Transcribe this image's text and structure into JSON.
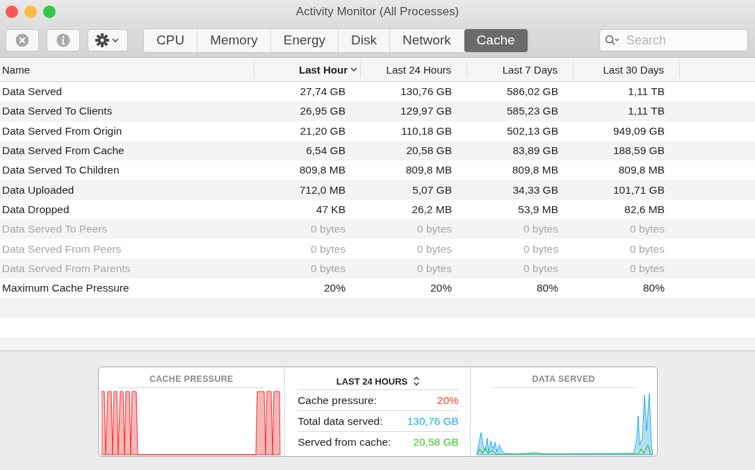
{
  "window": {
    "title": "Activity Monitor (All Processes)"
  },
  "toolbar": {
    "tabs": [
      {
        "label": "CPU",
        "selected": false
      },
      {
        "label": "Memory",
        "selected": false
      },
      {
        "label": "Energy",
        "selected": false
      },
      {
        "label": "Disk",
        "selected": false
      },
      {
        "label": "Network",
        "selected": false
      },
      {
        "label": "Cache",
        "selected": true
      }
    ],
    "search": {
      "placeholder": "Search"
    }
  },
  "table": {
    "columns": [
      {
        "label": "Name",
        "sorted": false
      },
      {
        "label": "Last Hour",
        "sorted": true
      },
      {
        "label": "Last 24 Hours",
        "sorted": false
      },
      {
        "label": "Last 7 Days",
        "sorted": false
      },
      {
        "label": "Last 30 Days",
        "sorted": false
      }
    ],
    "rows": [
      {
        "cells": [
          "Data Served",
          "27,74 GB",
          "130,76 GB",
          "586,02 GB",
          "1,11 TB"
        ],
        "disabled": false
      },
      {
        "cells": [
          "Data Served To Clients",
          "26,95 GB",
          "129,97 GB",
          "585,23 GB",
          "1,11 TB"
        ],
        "disabled": false
      },
      {
        "cells": [
          "Data Served From Origin",
          "21,20 GB",
          "110,18 GB",
          "502,13 GB",
          "949,09 GB"
        ],
        "disabled": false
      },
      {
        "cells": [
          "Data Served From Cache",
          "6,54 GB",
          "20,58 GB",
          "83,89 GB",
          "188,59 GB"
        ],
        "disabled": false
      },
      {
        "cells": [
          "Data Served To Children",
          "809,8 MB",
          "809,8 MB",
          "809,8 MB",
          "809,8 MB"
        ],
        "disabled": false
      },
      {
        "cells": [
          "Data Uploaded",
          "712,0 MB",
          "5,07 GB",
          "34,33 GB",
          "101,71 GB"
        ],
        "disabled": false
      },
      {
        "cells": [
          "Data Dropped",
          "47 KB",
          "26,2 MB",
          "53,9 MB",
          "82,6 MB"
        ],
        "disabled": false
      },
      {
        "cells": [
          "Data Served To Peers",
          "0 bytes",
          "0 bytes",
          "0 bytes",
          "0 bytes"
        ],
        "disabled": true
      },
      {
        "cells": [
          "Data Served From Peers",
          "0 bytes",
          "0 bytes",
          "0 bytes",
          "0 bytes"
        ],
        "disabled": true
      },
      {
        "cells": [
          "Data Served From Parents",
          "0 bytes",
          "0 bytes",
          "0 bytes",
          "0 bytes"
        ],
        "disabled": true
      },
      {
        "cells": [
          "Maximum Cache Pressure",
          "20%",
          "20%",
          "80%",
          "80%"
        ],
        "disabled": false
      }
    ]
  },
  "summary": {
    "left_title": "CACHE PRESSURE",
    "period": "LAST 24 HOURS",
    "stats": [
      {
        "label": "Cache pressure:",
        "value": "20%",
        "color": "#ff3b30"
      },
      {
        "label": "Total data served:",
        "value": "130,76 GB",
        "color": "#1badf8"
      },
      {
        "label": "Served from cache:",
        "value": "20,58 GB",
        "color": "#3ec928"
      }
    ],
    "right_title": "DATA SERVED"
  }
}
